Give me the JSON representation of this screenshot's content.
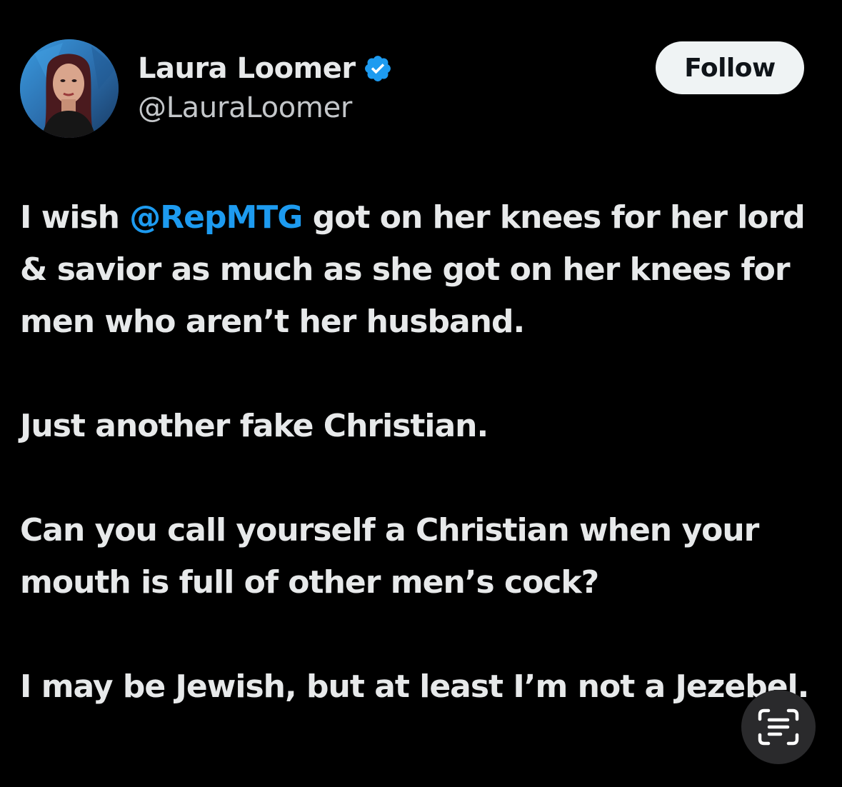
{
  "author": {
    "display_name": "Laura Loomer",
    "handle": "@LauraLoomer",
    "verified_icon": "verified-badge-icon",
    "verified_color": "#1d9bf0"
  },
  "follow_button": {
    "label": "Follow"
  },
  "tweet": {
    "p1_before": "I wish ",
    "p1_mention": "@RepMTG",
    "p1_after": " got on her knees for her lord & savior as much as she got on her knees for men who aren’t her husband.",
    "p2": "Just another fake Christian.",
    "p3": "Can you call yourself a Christian when your mouth is full of other men’s cock?",
    "p4": "I may be Jewish, but at least I’m not a Jezebel."
  },
  "overlay": {
    "scan_text_icon": "live-text-scan-icon"
  },
  "colors": {
    "background": "#000000",
    "text": "#e7e9ea",
    "mention": "#1d9bf0",
    "follow_bg": "#eff3f4"
  }
}
